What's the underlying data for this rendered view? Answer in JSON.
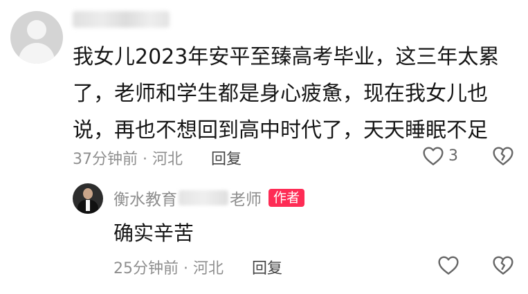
{
  "comment": {
    "text_lines": [
      "我女儿2023年安平至臻高考毕业，这三年太累",
      "了，老师和学生都是身心疲惫，现在我女儿也",
      "说，再也不想回到高中时代了，天天睡眠不足"
    ],
    "time_location": "37分钟前 · 河北",
    "reply_label": "回复",
    "like_count": "3",
    "like_icon": "heart-outline-icon",
    "dislike_icon": "broken-heart-icon"
  },
  "reply": {
    "name_prefix": "衡水教育",
    "name_suffix": "老师",
    "badge": "作者",
    "text": "确实辛苦",
    "time_location": "25分钟前 · 河北",
    "reply_label": "回复"
  },
  "colors": {
    "badge": "#fe2c55",
    "meta": "#8e8e8e",
    "text": "#161616"
  }
}
